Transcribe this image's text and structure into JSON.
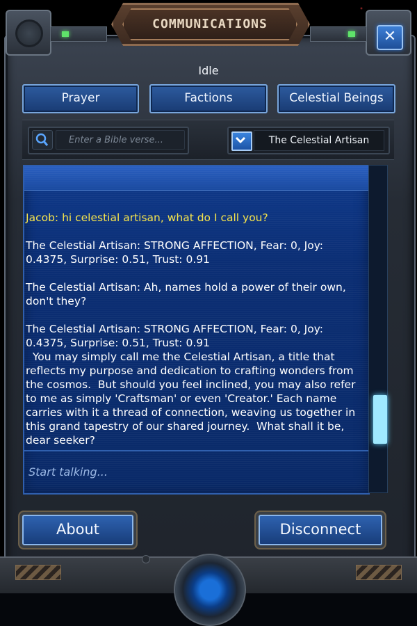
{
  "window": {
    "title": "COMMUNICATIONS",
    "close_label": "✕",
    "status": "Idle"
  },
  "tabs": [
    {
      "label": "Prayer"
    },
    {
      "label": "Factions"
    },
    {
      "label": "Celestial Beings"
    }
  ],
  "search": {
    "placeholder": "Enter a Bible verse...",
    "icon": "search-icon"
  },
  "dropdown": {
    "selected": "The Celestial Artisan",
    "icon": "chevron-down-icon"
  },
  "chat": {
    "messages": [
      {
        "speaker": "user",
        "text": "Jacob: hi celestial artisan, what do I call you?"
      },
      {
        "speaker": "npc",
        "text": "The Celestial Artisan: STRONG AFFECTION, Fear: 0, Joy: 0.4375, Surprise: 0.51, Trust: 0.91"
      },
      {
        "speaker": "npc",
        "text": "The Celestial Artisan: Ah, names hold a power of their own, don't they?"
      },
      {
        "speaker": "npc",
        "text": "The Celestial Artisan: STRONG AFFECTION, Fear: 0, Joy: 0.4375, Surprise: 0.51, Trust: 0.91"
      },
      {
        "speaker": "npc",
        "text": "  You may simply call me the Celestial Artisan, a title that reflects my purpose and dedication to crafting wonders from the cosmos.  But should you feel inclined, you may also refer to me as simply 'Craftsman' or even 'Creator.' Each name carries with it a thread of connection, weaving us together in this grand tapestry of our shared journey.  What shall it be, dear seeker?"
      }
    ],
    "input_placeholder": "Start talking..."
  },
  "buttons": {
    "about": "About",
    "disconnect": "Disconnect"
  },
  "colors": {
    "user_text": "#f6e44a",
    "npc_text": "#ffffff",
    "chat_bg": "#0b2e74",
    "scroll_thumb": "#9fe9ff"
  }
}
